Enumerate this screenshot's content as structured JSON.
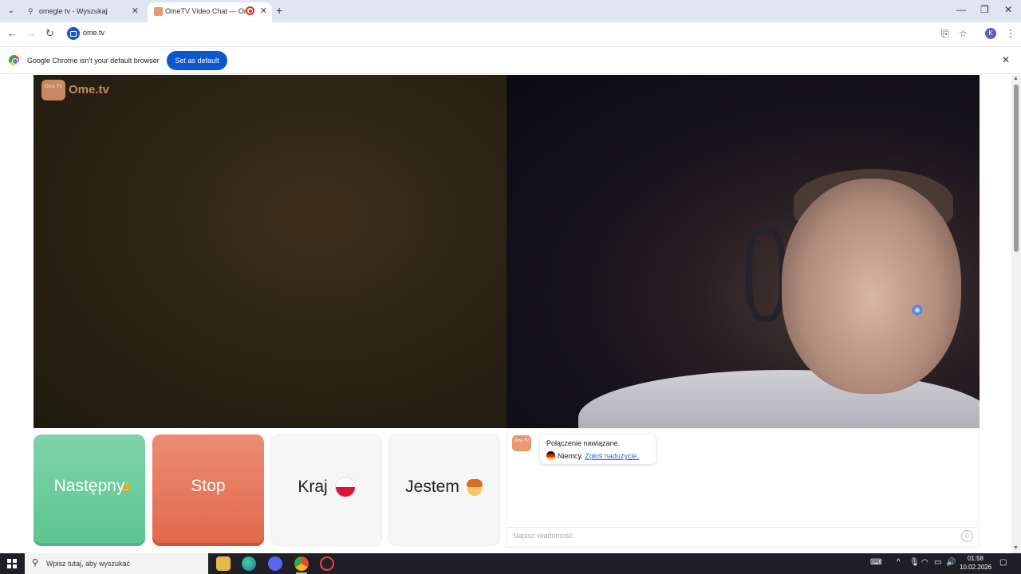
{
  "browser": {
    "tabs": [
      {
        "title": "omegle tv - Wyszukaj",
        "active": false
      },
      {
        "title": "OmeTV Video Chat — Ome",
        "active": true
      }
    ],
    "url": "ome.tv",
    "profile_initial": "K",
    "infobar": {
      "text": "Google Chrome isn't your default browser",
      "button": "Set as default"
    }
  },
  "page": {
    "logo_text": "Ome.tv",
    "logo_badge": "Ome TV",
    "buttons": {
      "next": "Następny",
      "stop": "Stop",
      "country": "Kraj",
      "me": "Jestem"
    },
    "chat": {
      "avatar_label": "Ome TV",
      "status": "Połączenie nawiązane.",
      "country": "Niemcy.",
      "report_link": "Zgłoś nadużycie.",
      "input_placeholder": "Napisz wiadomość"
    }
  },
  "taskbar": {
    "search_placeholder": "Wpisz tutaj, aby wyszukać",
    "time": "01:58",
    "date": "10.02.2026"
  },
  "colors": {
    "next_button": "#6ccb9c",
    "stop_button": "#e97558",
    "accent_blue": "#0b57d0",
    "brand_orange": "#e79a6f"
  },
  "icons": [
    "chevron-down-icon",
    "search-icon",
    "close-icon",
    "recording-icon",
    "plus-icon",
    "minimize-icon",
    "restore-icon",
    "back-arrow-icon",
    "forward-arrow-icon",
    "reload-icon",
    "install-icon",
    "star-icon",
    "menu-dots-icon",
    "chrome-logo-icon",
    "poland-flag-icon",
    "boy-emoji-icon",
    "germany-flag-icon",
    "smiley-icon",
    "windows-start-icon"
  ]
}
